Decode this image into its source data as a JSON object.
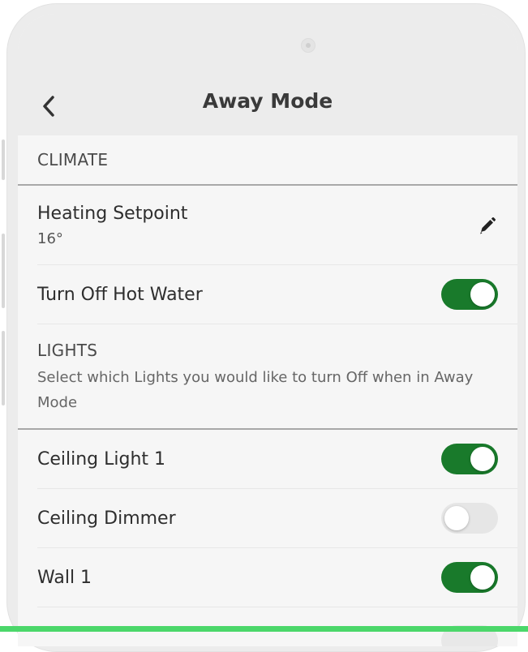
{
  "header": {
    "title": "Away Mode",
    "back_icon": "chevron-left-icon"
  },
  "climate": {
    "section_title": "CLIMATE",
    "heating_setpoint": {
      "label": "Heating Setpoint",
      "value": "16°",
      "edit_icon": "pencil-icon"
    },
    "hot_water": {
      "label": "Turn Off Hot Water",
      "on": true
    }
  },
  "lights": {
    "section_title": "LIGHTS",
    "description": "Select which Lights you would like to turn Off when in Away Mode",
    "items": [
      {
        "label": "Ceiling Light 1",
        "on": true
      },
      {
        "label": "Ceiling Dimmer",
        "on": false
      },
      {
        "label": "Wall 1",
        "on": true
      }
    ]
  },
  "colors": {
    "toggle_on": "#197a2b",
    "toggle_off": "#e6e6e6",
    "bottom_accent": "#4bd76a"
  }
}
